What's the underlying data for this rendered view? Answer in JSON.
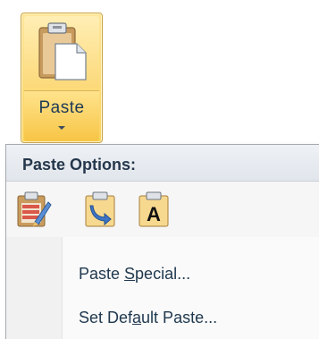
{
  "ribbon": {
    "paste_label": "Paste"
  },
  "menu": {
    "header": "Paste Options:",
    "options": [
      {
        "icon": "keep-source-formatting-icon"
      },
      {
        "icon": "merge-formatting-icon"
      },
      {
        "icon": "keep-text-only-icon",
        "glyph": "A"
      }
    ],
    "items": [
      {
        "before": "Paste ",
        "mnemonic": "S",
        "after": "pecial..."
      },
      {
        "before": "Set Def",
        "mnemonic": "a",
        "after": "ult Paste..."
      }
    ]
  },
  "colors": {
    "highlight_yellow": "#fbd35f",
    "text_navy": "#20394f"
  }
}
